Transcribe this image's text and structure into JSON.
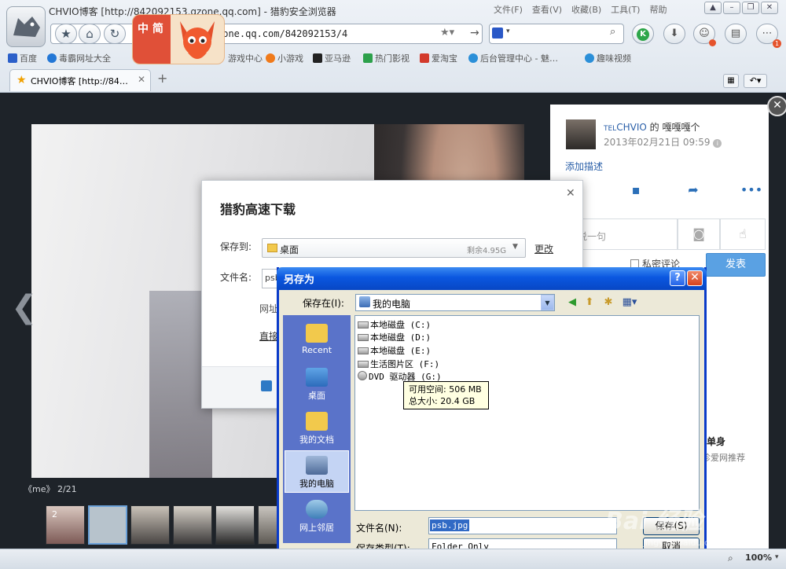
{
  "browser": {
    "window_title": "CHVIO博客 [http://842092153.qzone.qq.com] - 猎豹安全浏览器",
    "menus": [
      "文件(F)",
      "查看(V)",
      "收藏(B)",
      "工具(T)",
      "帮助"
    ],
    "url": "zone.qq.com/842092153/4",
    "tab_title": "CHVIO博客 [http://84…",
    "new_tab": "+",
    "zoom": "100%",
    "bookmarks": [
      {
        "label": "百度",
        "color": "#2b5fc9"
      },
      {
        "label": "毒霸网址大全",
        "color": "#2377d6"
      },
      {
        "label": "游戏中心",
        "color": "#e38a1d"
      },
      {
        "label": "小游戏",
        "color": "#f07a1a"
      },
      {
        "label": "亚马逊",
        "color": "#222222"
      },
      {
        "label": "热门影视",
        "color": "#2da14b"
      },
      {
        "label": "爱淘宝",
        "color": "#d33a2c"
      },
      {
        "label": "后台管理中心 - 魅…",
        "color": "#2b8fd8"
      },
      {
        "label": "趣味视频",
        "color": "#2b8fd8"
      }
    ],
    "mascot_text": "中 简"
  },
  "viewer": {
    "caption": "《me》 2/21",
    "thumb_count": "2",
    "author_badge": "TEL",
    "author_name": "CHVIO",
    "author_of": "的",
    "author_suffix": "嘎嘎嘎个",
    "date": "2013年02月21日 09:59",
    "add_desc": "添加描述",
    "comment_placeholder": "说一句",
    "private_label": "私密评论",
    "send_label": "发表",
    "ad_title": "单身",
    "ad_sub": "珍爱网推荐"
  },
  "download_dialog": {
    "title": "猎豹高速下载",
    "save_to_label": "保存到:",
    "save_to_value": "桌面",
    "remaining": "剩余4.95G",
    "change": "更改",
    "filename_label": "文件名:",
    "filename_value": "psb",
    "url_label": "网址",
    "direct": "直接"
  },
  "saveas_dialog": {
    "title": "另存为",
    "look_in_label": "保存在(I):",
    "look_in_value": "我的电脑",
    "places": [
      "Recent",
      "桌面",
      "我的文档",
      "我的电脑",
      "网上邻居"
    ],
    "drives": [
      "本地磁盘 (C:)",
      "本地磁盘 (D:)",
      "本地磁盘 (E:)",
      "生活图片区 (F:)",
      "DVD 驱动器 (G:)"
    ],
    "tooltip_line1": "可用空间: 506 MB",
    "tooltip_line2": "总大小: 20.4 GB",
    "filename_label": "文件名(N):",
    "filename_value": "psb.jpg",
    "filetype_label": "保存类型(T):",
    "filetype_value": "Folder Only",
    "save_button": "保存(S)",
    "cancel_button": "取消"
  },
  "watermark": {
    "main": "Bai 经验",
    "sub": "jingyan.baidu.com"
  }
}
